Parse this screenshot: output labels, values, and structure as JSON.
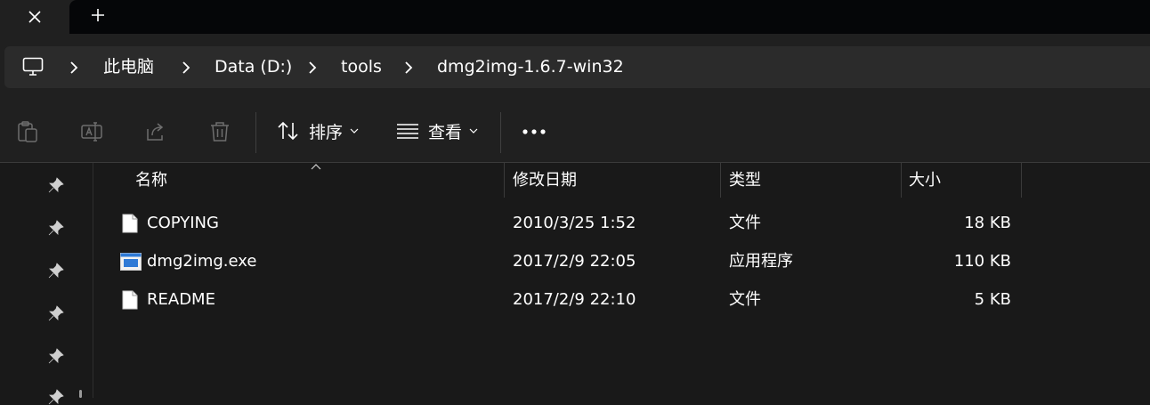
{
  "address_bar": {
    "crumbs": [
      "此电脑",
      "Data (D:)",
      "tools",
      "dmg2img-1.6.7-win32"
    ]
  },
  "toolbar": {
    "sort_label": "排序",
    "view_label": "查看"
  },
  "columns": {
    "name": "名称",
    "modified": "修改日期",
    "type": "类型",
    "size": "大小"
  },
  "files": [
    {
      "name": "COPYING",
      "modified": "2010/3/25 1:52",
      "type": "文件",
      "size": "18 KB",
      "icon": "file-icon"
    },
    {
      "name": "dmg2img.exe",
      "modified": "2017/2/9 22:05",
      "type": "应用程序",
      "size": "110 KB",
      "icon": "exe-icon"
    },
    {
      "name": "README",
      "modified": "2017/2/9 22:10",
      "type": "文件",
      "size": "5 KB",
      "icon": "file-icon"
    }
  ],
  "colors": {
    "background": "#191919",
    "chrome": "#202020",
    "address_bar": "#2b2b2b",
    "text": "#ffffff",
    "disabled_icon": "#6e6e6e",
    "exe_accent": "#2f7ad6"
  }
}
